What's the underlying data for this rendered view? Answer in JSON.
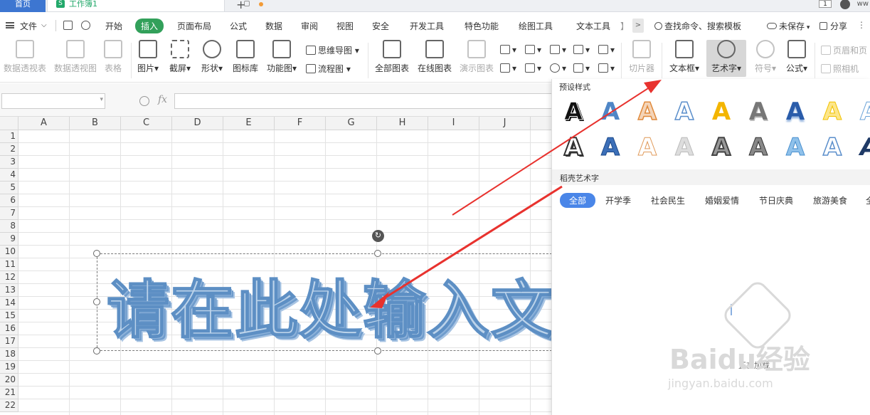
{
  "titlebar": {
    "home_tab": "首页",
    "doc_tab": "工作簿1",
    "doc_icon": "S",
    "badge": "1",
    "user_text": "ww"
  },
  "menubar": {
    "file": "文件",
    "items": [
      "开始",
      "插入",
      "页面布局",
      "公式",
      "数据",
      "审阅",
      "视图",
      "安全",
      "开发工具",
      "特色功能",
      "绘图工具",
      "文本工具"
    ],
    "active": "插入",
    "more": ">",
    "search": "查找命令、搜索模板",
    "unsaved": "未保存",
    "share": "分享"
  },
  "ribbon": {
    "pivot_table": "数据透视表",
    "pivot_chart": "数据透视图",
    "table": "表格",
    "picture": "图片",
    "screenshot": "截屏",
    "shape": "形状",
    "icon_lib": "图标库",
    "func_chart": "功能图",
    "mindmap": "思维导图",
    "flowchart": "流程图",
    "all_charts": "全部图表",
    "online_charts": "在线图表",
    "demo_chart": "演示图表",
    "slicer": "切片器",
    "textbox": "文本框",
    "wordart": "艺术字",
    "symbol": "符号",
    "formula": "公式",
    "header_footer": "页眉和页",
    "camera": "照相机"
  },
  "formula_bar": {
    "fx": "fx",
    "namebox_value": "",
    "formula_value": ""
  },
  "sheet": {
    "columns": [
      "A",
      "B",
      "C",
      "D",
      "E",
      "F",
      "G",
      "H",
      "I",
      "J"
    ],
    "rows": [
      "1",
      "2",
      "3",
      "4",
      "5",
      "6",
      "7",
      "8",
      "9",
      "10",
      "11",
      "12",
      "13",
      "14",
      "15",
      "16",
      "17",
      "18",
      "19",
      "20",
      "21",
      "22"
    ],
    "wordart_text": "请在此处输入文"
  },
  "panel": {
    "preset_title": "预设样式",
    "preset_glyph": "A",
    "daoke_title": "稻壳艺术字",
    "categories": [
      "全部",
      "开学季",
      "社会民生",
      "婚姻爱情",
      "节日庆典",
      "旅游美食"
    ],
    "active_category": "全部",
    "loading_text": "正在加载"
  },
  "watermark": {
    "brand": "Baidu经验",
    "url": "jingyan.baidu.com"
  },
  "colors": {
    "accent_green": "#32a05a",
    "home_blue": "#3d76d1",
    "arrow_red": "#e8322e",
    "wordart_blue": "#5d8fc4"
  }
}
